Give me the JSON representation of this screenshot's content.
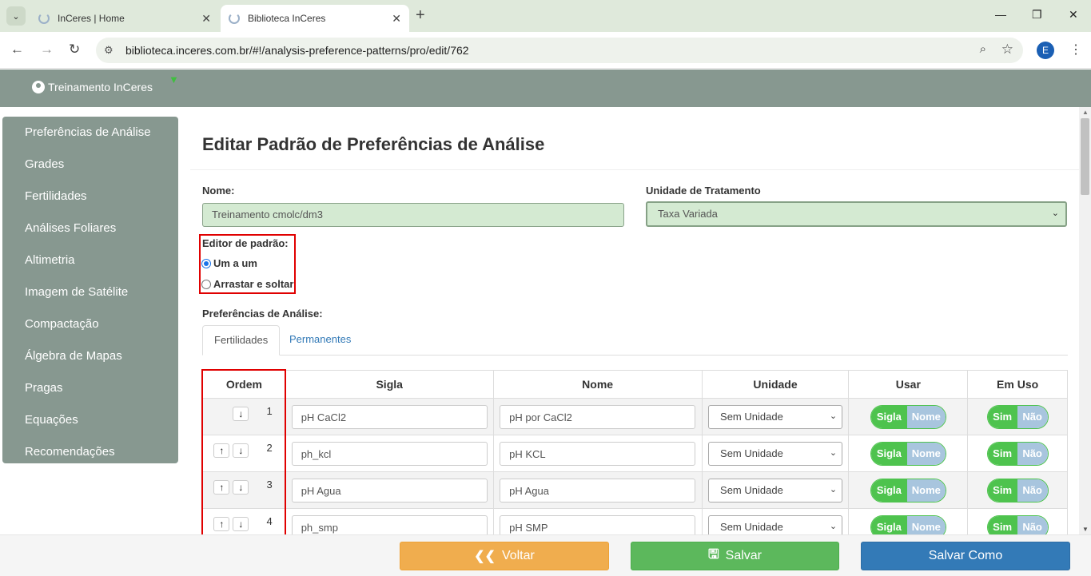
{
  "browser": {
    "tabs": [
      {
        "title": "InCeres | Home",
        "active": false
      },
      {
        "title": "Biblioteca InCeres",
        "active": true
      }
    ],
    "url": "biblioteca.inceres.com.br/#!/analysis-preference-patterns/pro/edit/762",
    "profile_initial": "E"
  },
  "header": {
    "user": "Treinamento InCeres"
  },
  "sidebar": {
    "items": [
      {
        "label": "Preferências de Análise"
      },
      {
        "label": "Grades"
      },
      {
        "label": "Fertilidades"
      },
      {
        "label": "Análises Foliares"
      },
      {
        "label": "Altimetria"
      },
      {
        "label": "Imagem de Satélite"
      },
      {
        "label": "Compactação"
      },
      {
        "label": "Álgebra de Mapas"
      },
      {
        "label": "Pragas"
      },
      {
        "label": "Equações"
      },
      {
        "label": "Recomendações"
      }
    ]
  },
  "page": {
    "title": "Editar Padrão de Preferências de Análise",
    "nome_label": "Nome:",
    "nome_value": "Treinamento cmolc/dm3",
    "unidade_label": "Unidade de Tratamento",
    "unidade_value": "Taxa Variada",
    "editor_label": "Editor de padrão:",
    "editor_options": [
      {
        "label": "Um a um",
        "selected": true
      },
      {
        "label": "Arrastar e soltar",
        "selected": false
      }
    ],
    "prefs_label": "Preferências de Análise:",
    "tabs": [
      {
        "label": "Fertilidades",
        "active": true
      },
      {
        "label": "Permanentes",
        "active": false
      }
    ]
  },
  "table": {
    "headers": [
      "Ordem",
      "Sigla",
      "Nome",
      "Unidade",
      "Usar",
      "Em Uso"
    ],
    "rows": [
      {
        "ordem": "1",
        "sigla": "pH CaCl2",
        "nome": "pH por CaCl2",
        "unidade": "Sem Unidade",
        "usar_on": "Sigla",
        "usar_off": "Nome",
        "emuso_on": "Sim",
        "emuso_off": "Não"
      },
      {
        "ordem": "2",
        "sigla": "ph_kcl",
        "nome": "pH KCL",
        "unidade": "Sem Unidade",
        "usar_on": "Sigla",
        "usar_off": "Nome",
        "emuso_on": "Sim",
        "emuso_off": "Não"
      },
      {
        "ordem": "3",
        "sigla": "pH Agua",
        "nome": "pH Agua",
        "unidade": "Sem Unidade",
        "usar_on": "Sigla",
        "usar_off": "Nome",
        "emuso_on": "Sim",
        "emuso_off": "Não"
      },
      {
        "ordem": "4",
        "sigla": "ph_smp",
        "nome": "pH SMP",
        "unidade": "Sem Unidade",
        "usar_on": "Sigla",
        "usar_off": "Nome",
        "emuso_on": "Sim",
        "emuso_off": "Não"
      }
    ]
  },
  "footer": {
    "voltar": "Voltar",
    "salvar": "Salvar",
    "salvar_como": "Salvar Como"
  }
}
